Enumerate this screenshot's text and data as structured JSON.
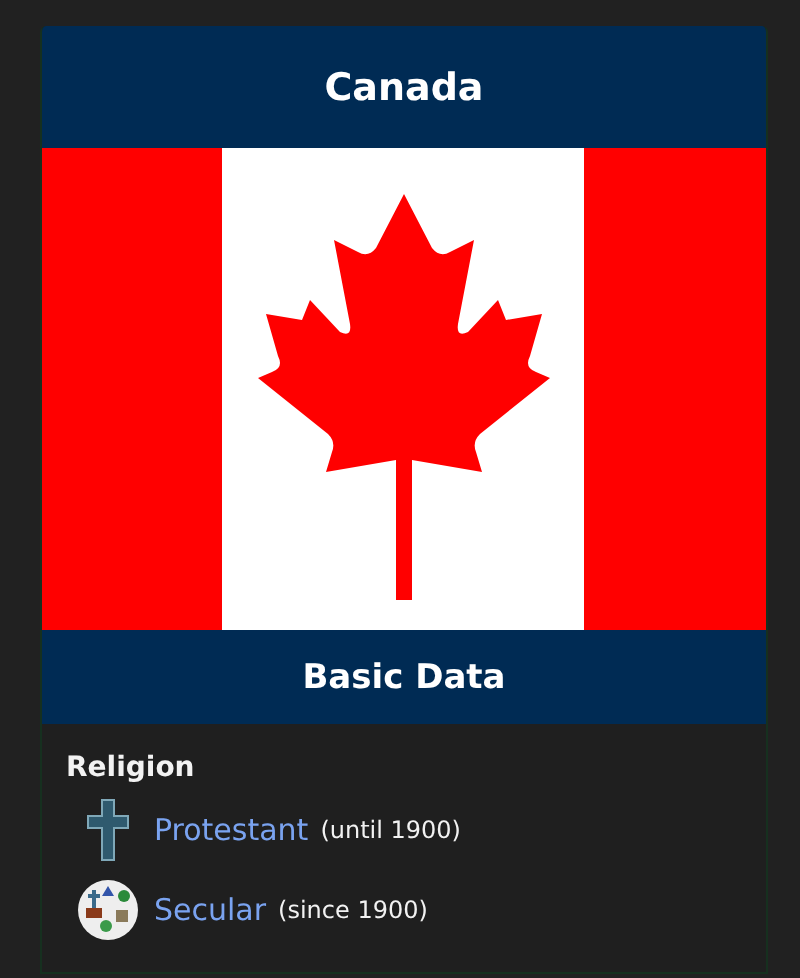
{
  "title": "Canada",
  "section_title": "Basic Data",
  "religion": {
    "label": "Religion",
    "items": [
      {
        "kind": "cross",
        "name": "Protestant",
        "note": "(until 1900)"
      },
      {
        "kind": "secular",
        "name": "Secular",
        "note": "(since 1900)"
      }
    ]
  }
}
